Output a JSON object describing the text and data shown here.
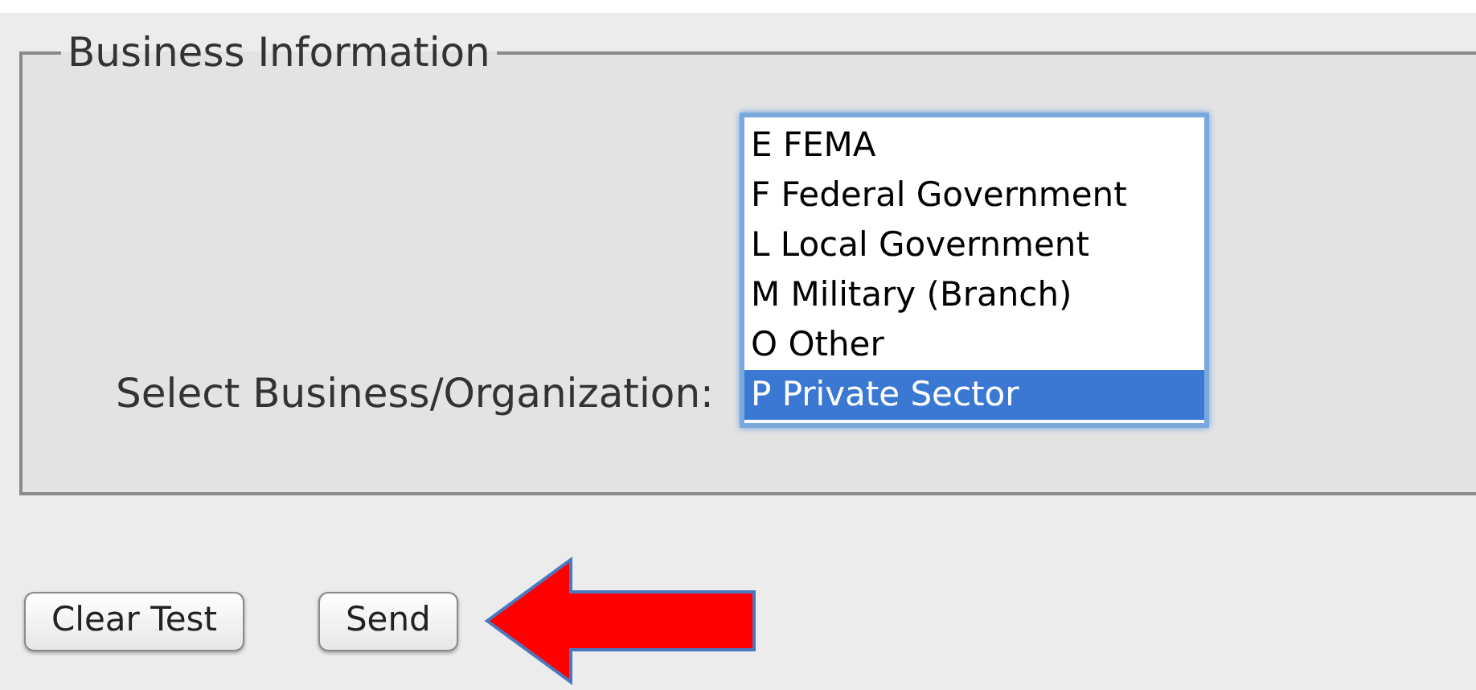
{
  "fieldset": {
    "legend": "Business Information",
    "label": "Select Business/Organization:",
    "options": [
      {
        "label": "E FEMA",
        "selected": false
      },
      {
        "label": "F Federal Government",
        "selected": false
      },
      {
        "label": "L Local Government",
        "selected": false
      },
      {
        "label": "M Military (Branch)",
        "selected": false
      },
      {
        "label": "O Other",
        "selected": false
      },
      {
        "label": "P Private Sector",
        "selected": true
      }
    ]
  },
  "buttons": [
    "Clear Test",
    "Send"
  ]
}
